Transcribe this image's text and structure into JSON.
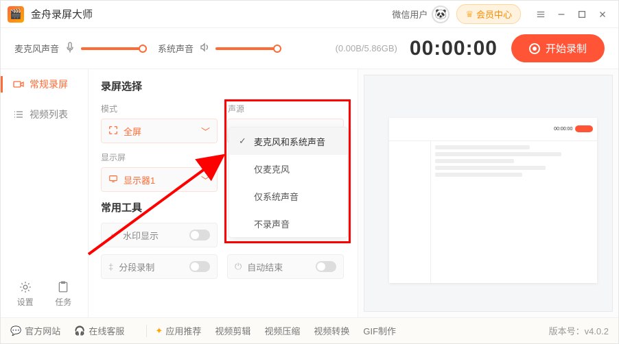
{
  "titlebar": {
    "app_title": "金舟录屏大师",
    "wechat_user": "微信用户",
    "vip_label": "会员中心"
  },
  "topstrip": {
    "mic_label": "麦克风声音",
    "sys_label": "系统声音",
    "disk": "(0.00B/5.86GB)",
    "timer": "00:00:00",
    "record_label": "开始录制"
  },
  "sidebar": {
    "items": [
      {
        "label": "常规录屏"
      },
      {
        "label": "视频列表"
      }
    ],
    "settings_label": "设置",
    "tasks_label": "任务"
  },
  "settings": {
    "section_title": "录屏选择",
    "mode_label": "模式",
    "source_label": "声源",
    "mode_value": "全屏",
    "source_value": "麦克风和系统声音",
    "display_label": "显示屏",
    "display_value": "显示器1",
    "tools_title": "常用工具",
    "tool_watermark": "水印显示",
    "tool_segment": "分段录制",
    "tool_autoend": "自动结束"
  },
  "dropdown": {
    "options": [
      "麦克风和系统声音",
      "仅麦克风",
      "仅系统声音",
      "不录声音"
    ]
  },
  "footer": {
    "site": "官方网站",
    "support": "在线客服",
    "apps": "应用推荐",
    "edit": "视频剪辑",
    "compress": "视频压缩",
    "convert": "视频转换",
    "gif": "GIF制作",
    "version_prefix": "版本号：",
    "version": "v4.0.2"
  }
}
